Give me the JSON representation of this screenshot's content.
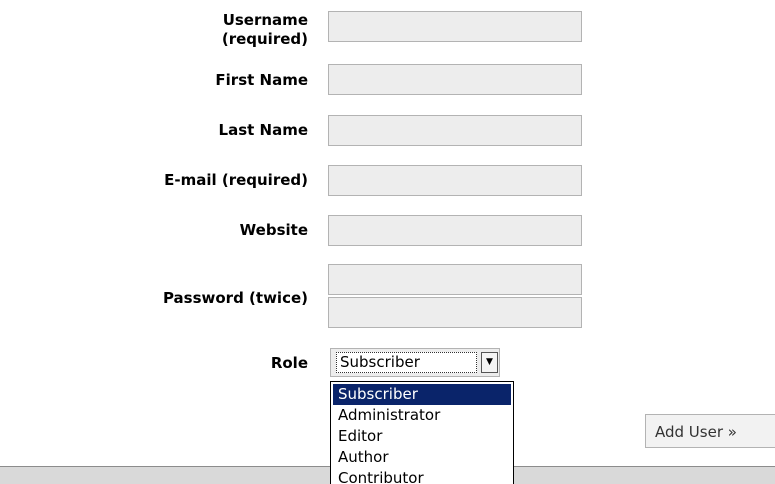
{
  "form": {
    "username_label_line1": "Username",
    "username_label_line2": "(required)",
    "username_value": "",
    "first_name_label": "First Name",
    "first_name_value": "",
    "last_name_label": "Last Name",
    "last_name_value": "",
    "email_label": "E-mail (required)",
    "email_value": "",
    "website_label": "Website",
    "website_value": "",
    "password_label": "Password (twice)",
    "password1_value": "",
    "password2_value": "",
    "role_label": "Role",
    "role_selected": "Subscriber",
    "role_options": [
      "Subscriber",
      "Administrator",
      "Editor",
      "Author",
      "Contributor"
    ],
    "add_user_label": "Add User »"
  },
  "icons": {
    "dropdown_arrow": "chevron-down-icon"
  },
  "colors": {
    "field_background": "#ededed",
    "field_border": "#b3b3b3",
    "highlight": "#0a246a",
    "footer": "#d9d9d9"
  }
}
